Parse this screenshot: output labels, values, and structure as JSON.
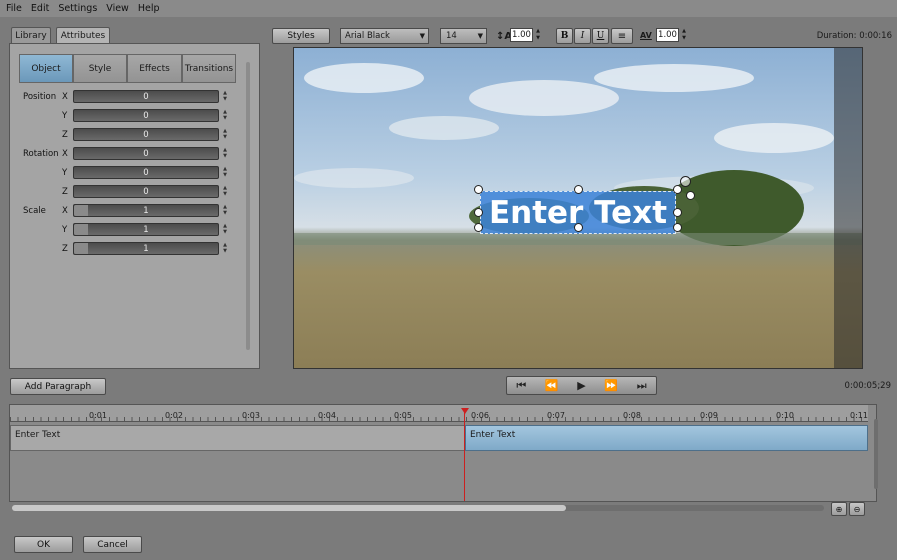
{
  "menu": [
    "File",
    "Edit",
    "Settings",
    "View",
    "Help"
  ],
  "left_tabs": [
    {
      "label": "Library"
    },
    {
      "label": "Attributes"
    }
  ],
  "sub_tabs": [
    "Object",
    "Style",
    "Effects",
    "Transitions"
  ],
  "toolbar": {
    "styles_label": "Styles",
    "font": "Arial Black",
    "size": "14",
    "leading": "1.00",
    "spacing": "1.00",
    "bold": "B",
    "italic": "I",
    "underline": "U"
  },
  "duration": "Duration: 0:00:16",
  "props": {
    "position_label": "Position",
    "rotation_label": "Rotation",
    "scale_label": "Scale",
    "x": "X",
    "y": "Y",
    "z": "Z",
    "values": [
      "0",
      "0",
      "0",
      "0",
      "0",
      "0",
      "1",
      "1",
      "1"
    ]
  },
  "overlay_text": "Enter Text",
  "add_paragraph": "Add Paragraph",
  "timecode": "0:00:05;29",
  "ruler": [
    "0:01",
    "0:02",
    "0:03",
    "0:04",
    "0:05",
    "0:06",
    "0:07",
    "0:08",
    "0:09",
    "0:10",
    "0:11"
  ],
  "clips": [
    "Enter Text",
    "Enter Text"
  ],
  "ok": "OK",
  "cancel": "Cancel",
  "colors": {
    "accent": "#6fa3c8",
    "playhead": "#cc2020",
    "selection": "#3c82d8"
  }
}
